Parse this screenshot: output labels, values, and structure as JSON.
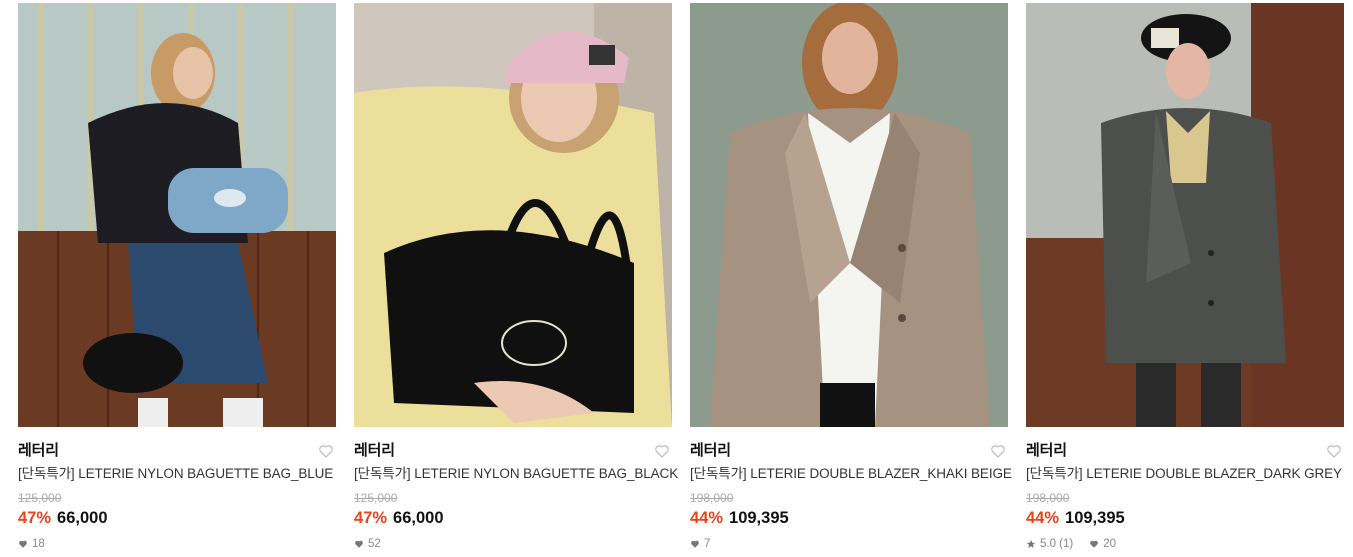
{
  "products": [
    {
      "brand": "레터리",
      "name": "[단독특가] LETERIE NYLON BAGUETTE BAG_BLUE",
      "original_price": "125,000",
      "discount": "47%",
      "price": "66,000",
      "likes": "18",
      "image_alt": "Model holding blue and black nylon baguette bags"
    },
    {
      "brand": "레터리",
      "name": "[단독특가] LETERIE NYLON BAGUETTE BAG_BLACK",
      "original_price": "125,000",
      "discount": "47%",
      "price": "66,000",
      "likes": "52",
      "image_alt": "Model in pink beanie with black baguette bag"
    },
    {
      "brand": "레터리",
      "name": "[단독특가] LETERIE DOUBLE BLAZER_KHAKI BEIGE",
      "original_price": "198,000",
      "discount": "44%",
      "price": "109,395",
      "likes": "7",
      "image_alt": "Model wearing khaki beige double blazer"
    },
    {
      "brand": "레터리",
      "name": "[단독특가] LETERIE DOUBLE BLAZER_DARK GREY",
      "original_price": "198,000",
      "discount": "44%",
      "price": "109,395",
      "rating": "5.0 (1)",
      "likes": "20",
      "image_alt": "Model wearing dark grey double blazer and beret"
    }
  ],
  "colors": {
    "discount": "#e8431c",
    "original_price": "#aaaaaa",
    "meta": "#888888"
  },
  "icons": {
    "wishlist": "heart-outline-icon",
    "likes": "heart-filled-icon",
    "rating": "star-icon"
  }
}
